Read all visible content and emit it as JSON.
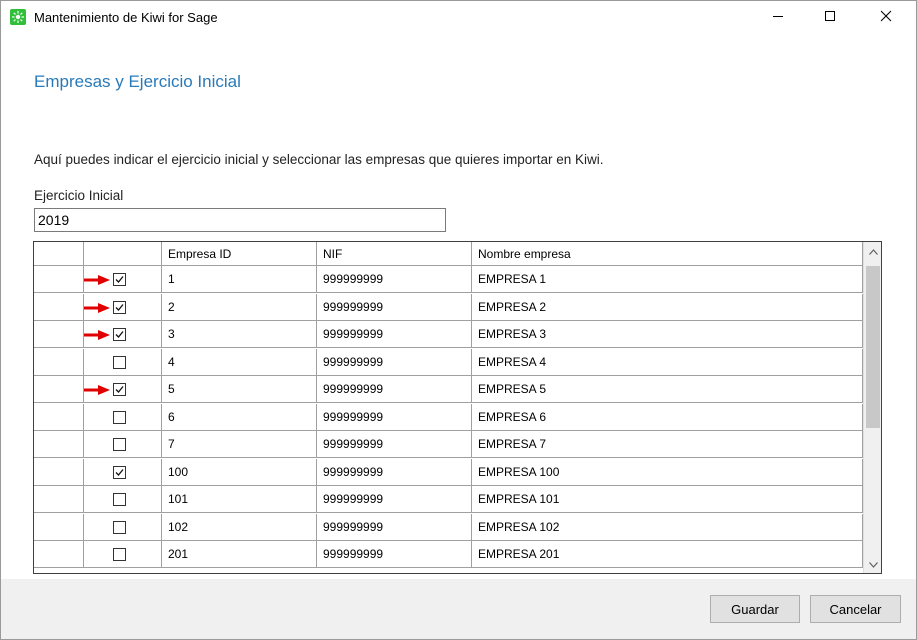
{
  "window": {
    "title": "Mantenimiento de Kiwi for Sage",
    "minimize_glyph": "—",
    "maximize_glyph": "☐",
    "close_glyph": "✕"
  },
  "page": {
    "heading": "Empresas y Ejercicio Inicial",
    "description": "Aquí puedes indicar el ejercicio inicial y seleccionar las empresas que quieres importar en Kiwi.",
    "ejercicio_label": "Ejercicio Inicial",
    "ejercicio_value": "2019"
  },
  "grid": {
    "columns": [
      "",
      "",
      "Empresa ID",
      "NIF",
      "Nombre empresa"
    ],
    "rows": [
      {
        "checked": true,
        "arrow": true,
        "id": "1",
        "nif": "999999999",
        "nombre": "EMPRESA 1"
      },
      {
        "checked": true,
        "arrow": true,
        "id": "2",
        "nif": "999999999",
        "nombre": "EMPRESA 2"
      },
      {
        "checked": true,
        "arrow": true,
        "id": "3",
        "nif": "999999999",
        "nombre": "EMPRESA 3"
      },
      {
        "checked": false,
        "arrow": false,
        "id": "4",
        "nif": "999999999",
        "nombre": "EMPRESA 4"
      },
      {
        "checked": true,
        "arrow": true,
        "id": "5",
        "nif": "999999999",
        "nombre": "EMPRESA 5"
      },
      {
        "checked": false,
        "arrow": false,
        "id": "6",
        "nif": "999999999",
        "nombre": "EMPRESA 6"
      },
      {
        "checked": false,
        "arrow": false,
        "id": "7",
        "nif": "999999999",
        "nombre": "EMPRESA 7"
      },
      {
        "checked": true,
        "arrow": false,
        "id": "100",
        "nif": "999999999",
        "nombre": "EMPRESA 100"
      },
      {
        "checked": false,
        "arrow": false,
        "id": "101",
        "nif": "999999999",
        "nombre": "EMPRESA 101"
      },
      {
        "checked": false,
        "arrow": false,
        "id": "102",
        "nif": "999999999",
        "nombre": "EMPRESA 102"
      },
      {
        "checked": false,
        "arrow": false,
        "id": "201",
        "nif": "999999999",
        "nombre": "EMPRESA 201"
      }
    ]
  },
  "footer": {
    "save_label": "Guardar",
    "cancel_label": "Cancelar"
  },
  "colors": {
    "heading": "#2a7ab8",
    "arrow": "#e00000",
    "app_icon": "#2fbf3a"
  }
}
